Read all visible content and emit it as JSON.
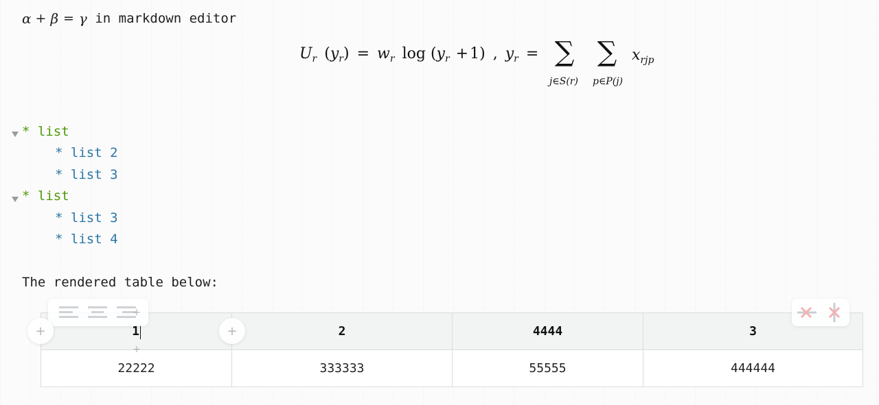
{
  "line1": {
    "math": {
      "alpha": "α",
      "plus": "+",
      "beta": "β",
      "equals": "=",
      "gamma": "γ"
    },
    "text": " in markdown editor"
  },
  "formula": {
    "U": "U",
    "r": "r",
    "y": "y",
    "w": "w",
    "x": "x",
    "rjp": "rjp",
    "log": "log",
    "lparen": "(",
    "rparen": ")",
    "plus": "+",
    "one": "1",
    "equals": "=",
    "comma": ",",
    "sigma": "∑",
    "lower1": "j∈S(r)",
    "lower2": "p∈P(j)"
  },
  "lists": [
    {
      "bullet": "* ",
      "label": "list",
      "children": [
        "* list 2",
        "* list 3"
      ]
    },
    {
      "bullet": "* ",
      "label": "list",
      "children": [
        "* list 3",
        "* list 4"
      ]
    }
  ],
  "paragraph": "The rendered table below:",
  "table": {
    "headers": [
      "1",
      "2",
      "4444",
      "3"
    ],
    "rows": [
      [
        "22222",
        "333333",
        "55555",
        "444444"
      ]
    ]
  },
  "table_tools": {
    "add_symbol": "+",
    "colors": {
      "align_icon": "#cfd2d6",
      "delete_icon": "#f2b2b2",
      "delete_icon_alt": "#c9cdd2"
    }
  },
  "colors": {
    "list_top": "#4e9a06",
    "list_sub": "#2a76a6",
    "text": "#1e1e1e"
  }
}
